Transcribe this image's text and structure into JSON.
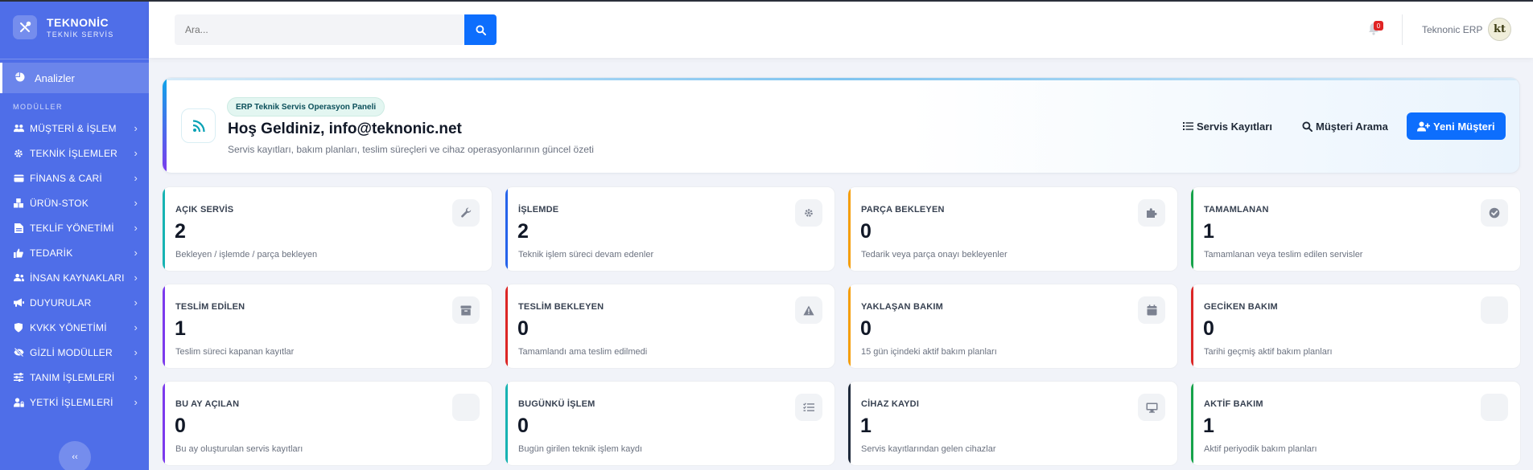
{
  "brand": {
    "title": "TEKNONİC",
    "subtitle": "TEKNİK SERVİS",
    "logo_icon": "tools-icon"
  },
  "sidebar": {
    "active_item": {
      "label": "Analizler",
      "icon": "chart-pie-icon"
    },
    "section_label": "MODÜLLER",
    "items": [
      {
        "label": "MÜŞTERİ & İŞLEM",
        "icon": "users-icon"
      },
      {
        "label": "TEKNİK İŞLEMLER",
        "icon": "gear-icon"
      },
      {
        "label": "FİNANS & CARİ",
        "icon": "credit-card-icon"
      },
      {
        "label": "ÜRÜN-STOK",
        "icon": "boxes-icon"
      },
      {
        "label": "TEKLİF YÖNETİMİ",
        "icon": "file-invoice-icon"
      },
      {
        "label": "TEDARİK",
        "icon": "thumbs-up-icon"
      },
      {
        "label": "İNSAN KAYNAKLARI",
        "icon": "user-group-icon"
      },
      {
        "label": "DUYURULAR",
        "icon": "megaphone-icon"
      },
      {
        "label": "KVKK YÖNETİMİ",
        "icon": "shield-icon"
      },
      {
        "label": "GİZLİ MODÜLLER",
        "icon": "eye-slash-icon"
      },
      {
        "label": "TANIM İŞLEMLERİ",
        "icon": "sliders-icon"
      },
      {
        "label": "YETKİ İŞLEMLERİ",
        "icon": "user-lock-icon"
      }
    ],
    "collapse_label": "‹‹"
  },
  "topbar": {
    "search_placeholder": "Ara...",
    "notification_count": "0",
    "user_name": "Teknonic ERP",
    "avatar_text": "kt"
  },
  "hero": {
    "badge": "ERP Teknik Servis Operasyon Paneli",
    "title": "Hoş Geldiniz, info@teknonic.net",
    "subtitle": "Servis kayıtları, bakım planları, teslim süreçleri ve cihaz operasyonlarının güncel özeti",
    "buttons": {
      "service_records": "Servis Kayıtları",
      "customer_search": "Müşteri Arama",
      "new_customer": "Yeni Müşteri"
    }
  },
  "colors": {
    "sidebar": "#4f6ee8",
    "primary": "#0d6efd",
    "teal": "#17b3b3",
    "blue": "#2563eb",
    "orange": "#f59e0b",
    "green": "#16a34a",
    "purple": "#7c3aed",
    "red": "#dc2626",
    "dark": "#1e293b"
  },
  "cards": [
    {
      "title": "AÇIK SERVİS",
      "value": "2",
      "desc": "Bekleyen / işlemde / parça bekleyen",
      "icon": "wrench-icon",
      "color": "teal"
    },
    {
      "title": "İŞLEMDE",
      "value": "2",
      "desc": "Teknik işlem süreci devam edenler",
      "icon": "gear-icon",
      "color": "blue"
    },
    {
      "title": "PARÇA BEKLEYEN",
      "value": "0",
      "desc": "Tedarik veya parça onayı bekleyenler",
      "icon": "puzzle-icon",
      "color": "orange"
    },
    {
      "title": "TAMAMLANAN",
      "value": "1",
      "desc": "Tamamlanan veya teslim edilen servisler",
      "icon": "check-circle-icon",
      "color": "green"
    },
    {
      "title": "TESLİM EDİLEN",
      "value": "1",
      "desc": "Teslim süreci kapanan kayıtlar",
      "icon": "archive-icon",
      "color": "purple"
    },
    {
      "title": "TESLİM BEKLEYEN",
      "value": "0",
      "desc": "Tamamlandı ama teslim edilmedi",
      "icon": "warning-icon",
      "color": "red"
    },
    {
      "title": "YAKLAŞAN BAKIM",
      "value": "0",
      "desc": "15 gün içindeki aktif bakım planları",
      "icon": "calendar-icon",
      "color": "orange"
    },
    {
      "title": "GECİKEN BAKIM",
      "value": "0",
      "desc": "Tarihi geçmiş aktif bakım planları",
      "icon": "blank-icon",
      "color": "red"
    },
    {
      "title": "BU AY AÇILAN",
      "value": "0",
      "desc": "Bu ay oluşturulan servis kayıtları",
      "icon": "blank-icon",
      "color": "purple"
    },
    {
      "title": "BUGÜNKÜ İŞLEM",
      "value": "0",
      "desc": "Bugün girilen teknik işlem kaydı",
      "icon": "list-check-icon",
      "color": "teal"
    },
    {
      "title": "CİHAZ KAYDI",
      "value": "1",
      "desc": "Servis kayıtlarından gelen cihazlar",
      "icon": "desktop-icon",
      "color": "dark"
    },
    {
      "title": "AKTİF BAKIM",
      "value": "1",
      "desc": "Aktif periyodik bakım planları",
      "icon": "blank-icon",
      "color": "green"
    }
  ]
}
